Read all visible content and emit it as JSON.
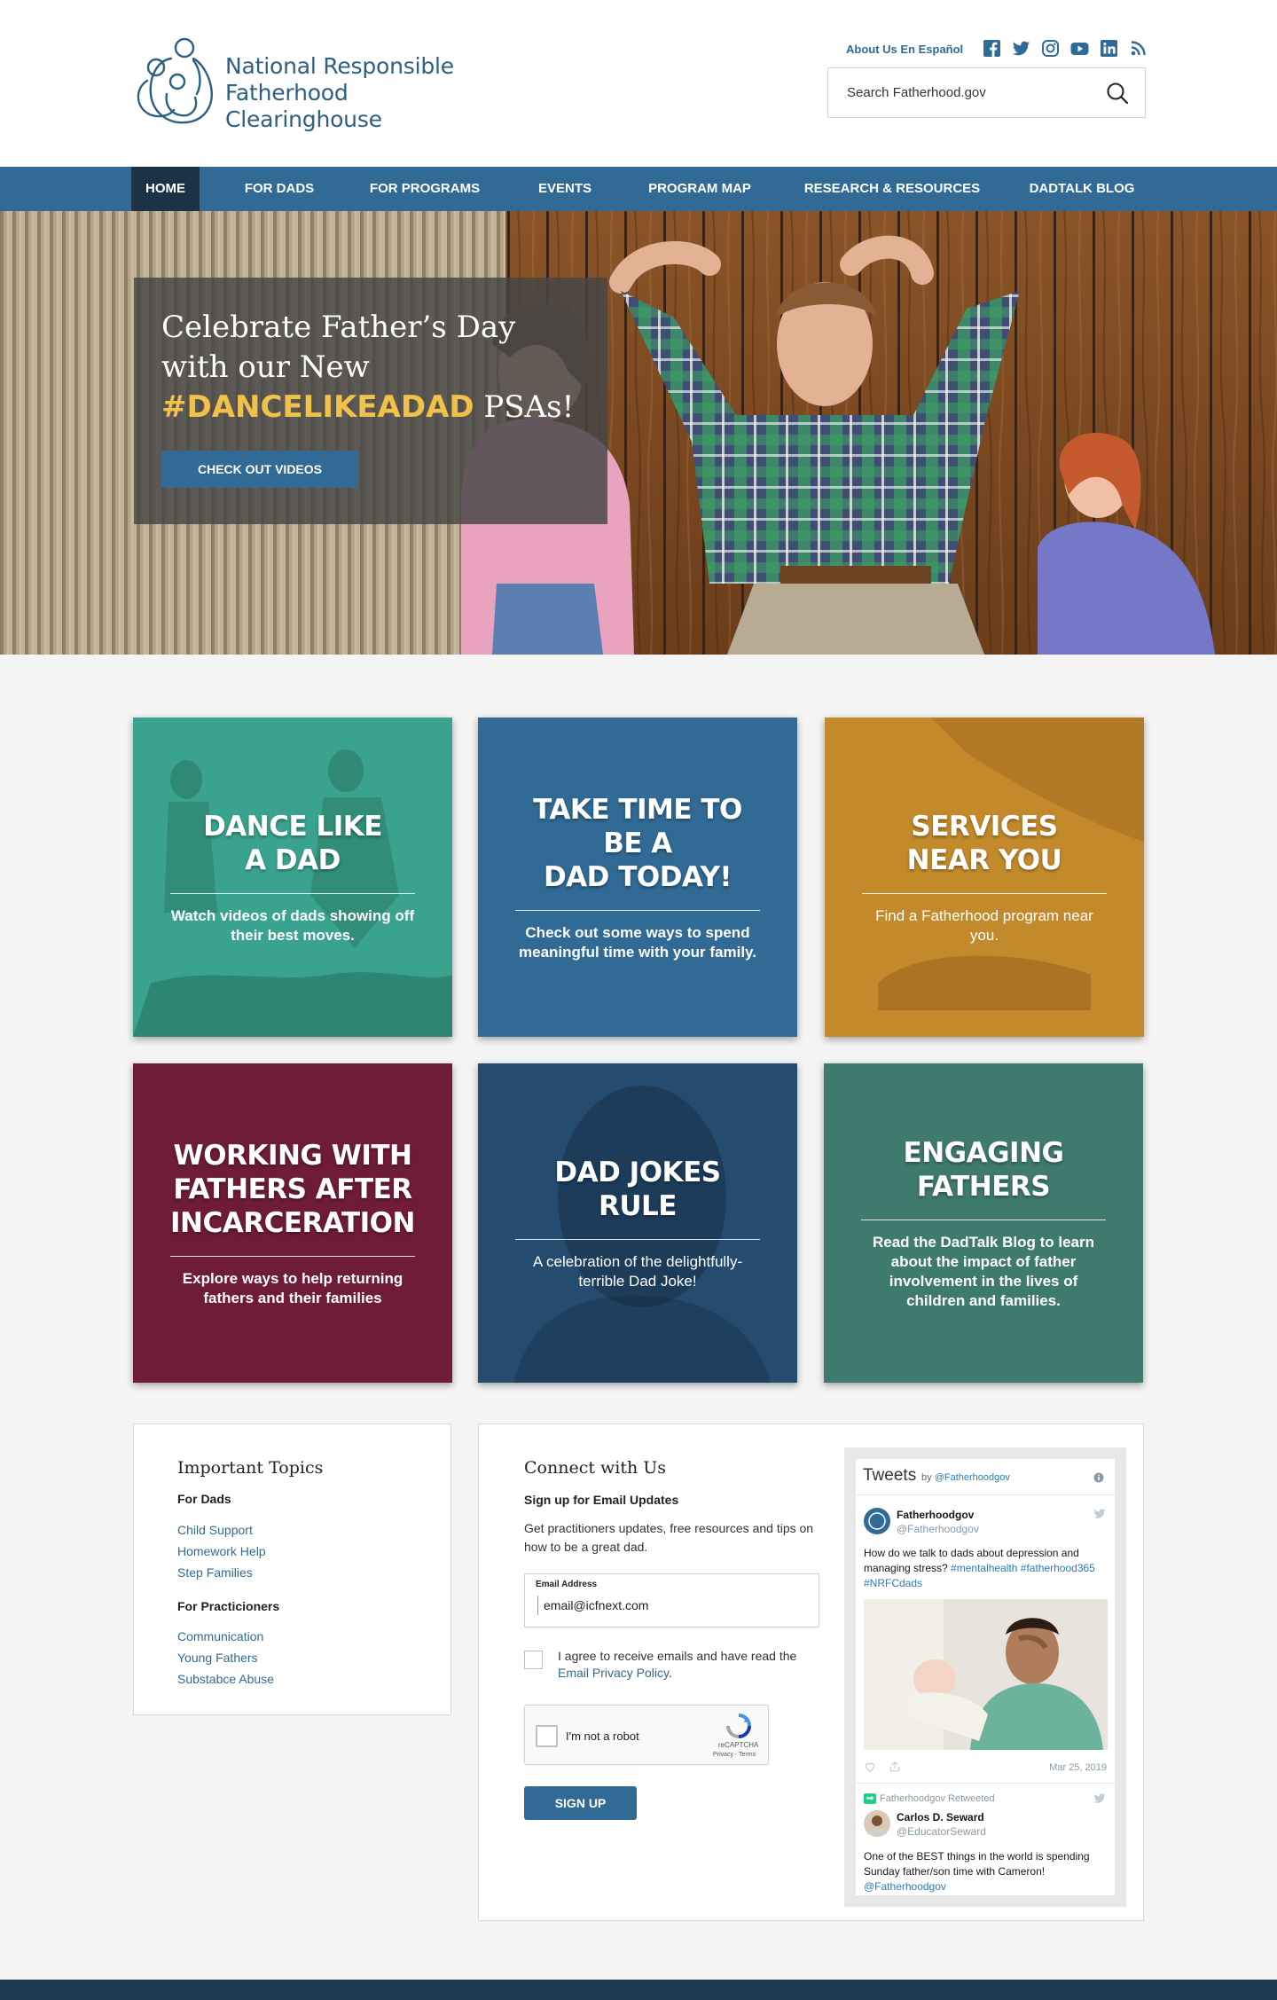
{
  "site": {
    "logo_line1": "National Responsible",
    "logo_line2": "Fatherhood Clearinghouse",
    "spanish_link": "About Us En Español",
    "social_icons": [
      "facebook-icon",
      "twitter-icon",
      "instagram-icon",
      "youtube-icon",
      "linkedin-icon",
      "rss-icon"
    ],
    "search_placeholder": "Search Fatherhood.gov"
  },
  "nav": {
    "items": [
      "HOME",
      "FOR DADS",
      "FOR PROGRAMS",
      "EVENTS",
      "PROGRAM MAP",
      "RESEARCH & RESOURCES",
      "DADTALK BLOG"
    ],
    "active": "HOME"
  },
  "hero": {
    "title_line1": "Celebrate Father’s Day",
    "title_line2": "with our New",
    "hashtag": "#DANCELIKEADAD",
    "title_end": " PSAs!",
    "button": "CHECK OUT VIDEOS"
  },
  "tiles": [
    {
      "title_l1": "DANCE LIKE",
      "title_l2": "A DAD",
      "title_l3": "",
      "text": "Watch videos of dads showing off their best moves.",
      "color": "#3aa38f"
    },
    {
      "title_l1": "TAKE TIME TO BE A",
      "title_l2": "DAD TODAY!",
      "title_l3": "",
      "text": "Check out some ways to spend meaningful time with your family.",
      "color": "#306a95"
    },
    {
      "title_l1": "SERVICES",
      "title_l2": "NEAR YOU",
      "title_l3": "",
      "text": "Find a Fatherhood program near you.",
      "color": "#c38a2b"
    },
    {
      "title_l1": "WORKING WITH",
      "title_l2": "FATHERS AFTER",
      "title_l3": "INCARCERATION",
      "text": "Explore ways to help returning fathers and their families",
      "color": "#6f1c36"
    },
    {
      "title_l1": "DAD JOKES",
      "title_l2": "RULE",
      "title_l3": "",
      "text": "A celebration of the delightfully-terrible Dad Joke!",
      "color": "#254b6e"
    },
    {
      "title_l1": "ENGAGING",
      "title_l2": "FATHERS",
      "title_l3": "",
      "text": "Read the DadTalk Blog to learn about the impact of father involvement in the lives of children and families.",
      "color": "#3f7a6f"
    }
  ],
  "topics": {
    "title": "Important Topics",
    "group1": "For Dads",
    "group1_links": [
      "Child Support",
      "Homework Help",
      "Step Families"
    ],
    "group2": "For Practicioners",
    "group2_links": [
      "Communication",
      "Young Fathers",
      "Substabce Abuse"
    ]
  },
  "connect": {
    "title": "Connect with Us",
    "subtitle": "Sign up for Email Updates",
    "desc_l1": "Get practitioners updates, free resources and tips on",
    "desc_l2": "how to be a great dad.",
    "email_label": "Email Address",
    "email_value": "email@icfnext.com",
    "agree_text": "I agree to receive emails and have read the",
    "privacy_link": "Email Privacy Policy",
    "captcha_text": "I'm not a robot",
    "captcha_brand": "reCAPTCHA",
    "captcha_small": "Privacy - Terms",
    "button": "SIGN UP"
  },
  "tweets": {
    "header": "Tweets",
    "by": "by",
    "handle": "@Fatherhoodgov",
    "t1_name": "Fatherhoodgov",
    "t1_handle": "@Fatherhoodgov",
    "t1_text_l1": "How do we talk to dads about depression and",
    "t1_text_l2": "managing stress?",
    "t1_tags_l2": " #mentalhealth #fatherhood365",
    "t1_tags_l3": "#NRFCdads",
    "t1_date": "Mar 25, 2019",
    "rt_label": "Fatherhoodgov Retweeted",
    "t2_name": "Carlos D. Seward",
    "t2_handle": "@EducatorSeward",
    "t2_text_l1": "One of the BEST things in the world is spending",
    "t2_text_l2": "Sunday father/son time with Cameron!",
    "t2_mention": "@Fatherhoodgov"
  }
}
